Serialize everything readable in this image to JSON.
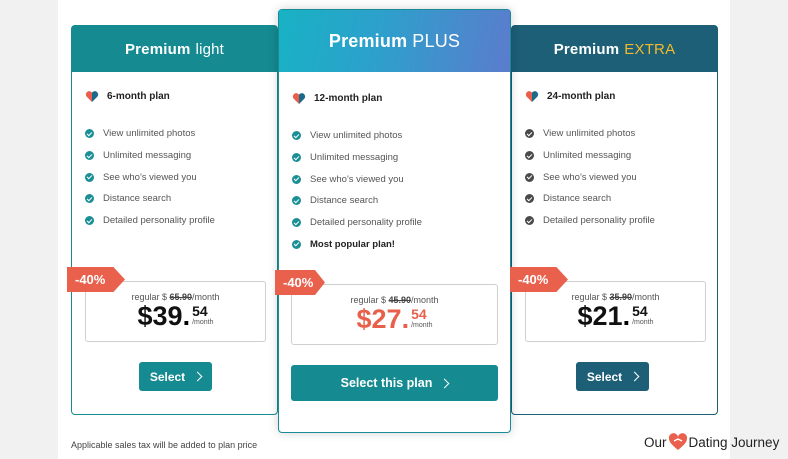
{
  "colors": {
    "teal": "#158a91",
    "navy": "#1c5f77",
    "discount": "#e9614d",
    "gold": "#f3b92a"
  },
  "plans": [
    {
      "id": "light",
      "title": "Premium",
      "suffix": "light",
      "duration": "6-month plan",
      "features": [
        "View unlimited photos",
        "Unlimited messaging",
        "See who's viewed you",
        "Distance search",
        "Detailed personality profile"
      ],
      "discount": "-40%",
      "regular_prefix": "regular $",
      "regular_price": "65.90",
      "regular_suffix": "/month",
      "price_whole": "$39",
      "price_cents": "54",
      "per": "/month",
      "button": "Select"
    },
    {
      "id": "plus",
      "title": "Premium",
      "suffix": "PLUS",
      "duration": "12-month plan",
      "features": [
        "View unlimited photos",
        "Unlimited messaging",
        "See who's viewed you",
        "Distance search",
        "Detailed personality profile",
        "Most popular plan!"
      ],
      "discount": "-40%",
      "regular_prefix": "regular $",
      "regular_price": "45.90",
      "regular_suffix": "/month",
      "price_whole": "$27",
      "price_cents": "54",
      "per": "/month",
      "button": "Select this plan"
    },
    {
      "id": "extra",
      "title": "Premium",
      "suffix": "EXTRA",
      "duration": "24-month plan",
      "features": [
        "View unlimited photos",
        "Unlimited messaging",
        "See who's viewed you",
        "Distance search",
        "Detailed personality profile"
      ],
      "discount": "-40%",
      "regular_prefix": "regular $",
      "regular_price": "35.90",
      "regular_suffix": "/month",
      "price_whole": "$21",
      "price_cents": "54",
      "per": "/month",
      "button": "Select"
    }
  ],
  "footer": {
    "tax_note": "Applicable sales tax will be added to plan price"
  },
  "brand": {
    "left": "Our",
    "right": "Dating Journey"
  },
  "icons": {
    "plan": "heart-icon",
    "feature": "check-circle-icon",
    "button": "chevron-right-icon"
  }
}
